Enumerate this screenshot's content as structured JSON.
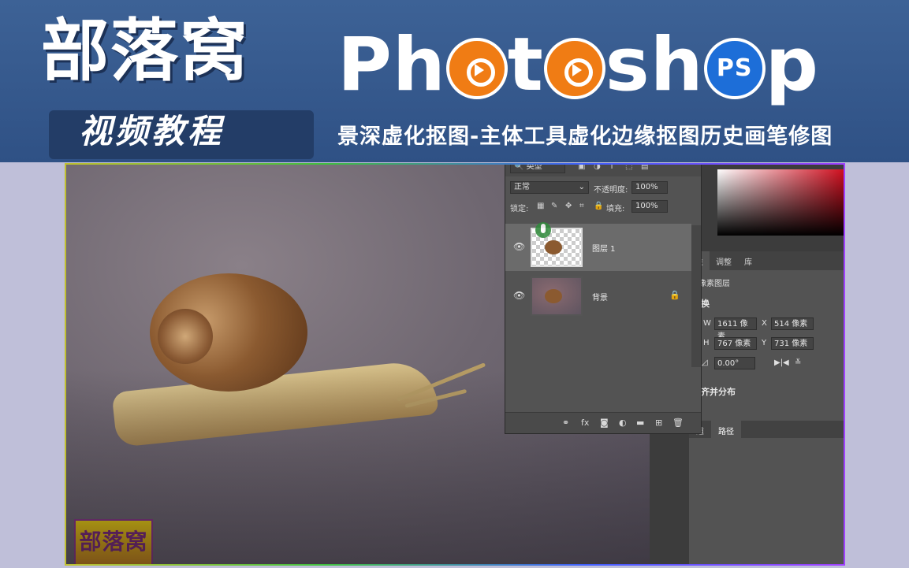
{
  "banner": {
    "brand_cn": "部落窝",
    "course_label": "视频教程",
    "app_word_prefix": "Ph",
    "app_word_mid1": "t",
    "app_word_mid2": "sh",
    "app_word_suffix": "p",
    "app_badge": "PS",
    "subtitle": "景深虚化抠图-主体工具虚化边缘抠图历史画笔修图",
    "accent_orange": "#f07c14",
    "accent_blue": "#1d6ed8"
  },
  "canvas": {
    "corner_logo": "部落窝"
  },
  "layers_panel": {
    "kind_filter": "类型",
    "blend_mode": "正常",
    "opacity_label": "不透明度:",
    "opacity_value": "100%",
    "lock_label": "锁定:",
    "fill_label": "填充:",
    "fill_value": "100%",
    "layers": [
      {
        "name": "图层 1",
        "selected": true
      },
      {
        "name": "背景",
        "selected": false,
        "locked": true
      }
    ]
  },
  "properties_panel": {
    "tabs": [
      "性",
      "调整",
      "库"
    ],
    "layer_type": "像素图层",
    "transform_title": "变换",
    "w_label": "W",
    "w_value": "1611 像素",
    "x_label": "X",
    "x_value": "514 像素",
    "h_label": "H",
    "h_value": "767 像素",
    "y_label": "Y",
    "y_value": "731 像素",
    "angle_value": "0.00°",
    "align_title": "对齐并分布"
  },
  "paths_panel": {
    "tabs": [
      "道",
      "路径"
    ]
  }
}
